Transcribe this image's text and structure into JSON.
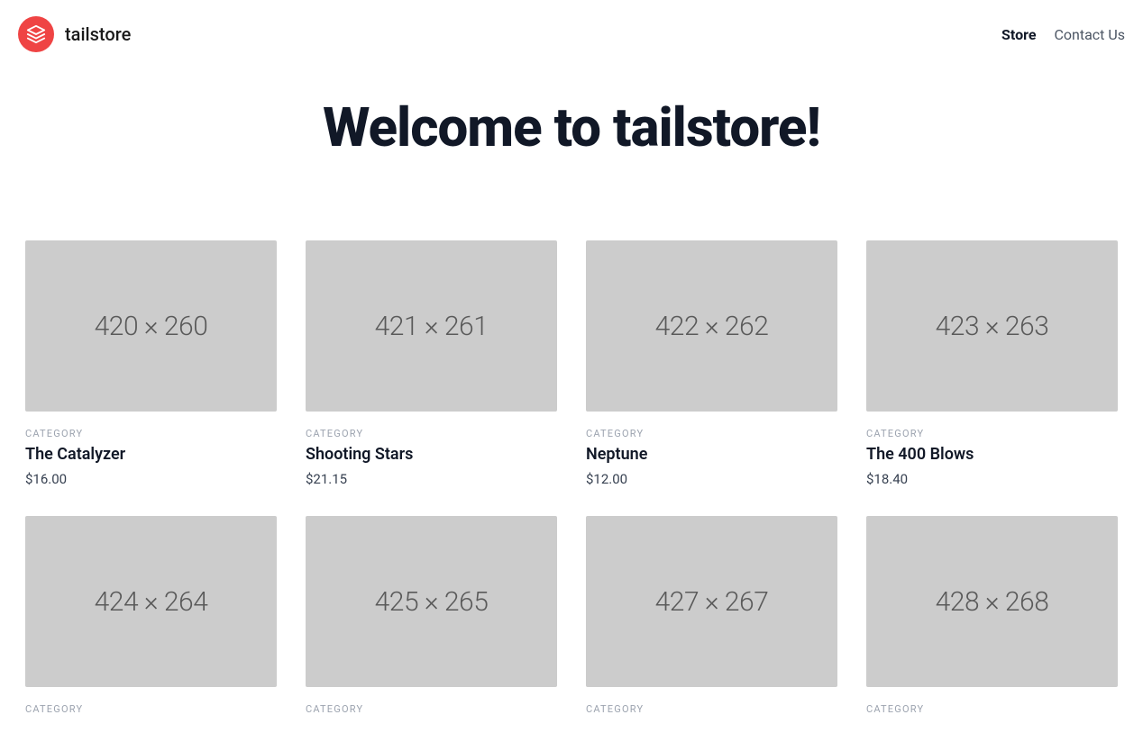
{
  "header": {
    "brand_name": "tailstore",
    "nav": [
      {
        "label": "Store",
        "active": true
      },
      {
        "label": "Contact Us",
        "active": false
      }
    ]
  },
  "hero": {
    "title": "Welcome to tailstore!"
  },
  "products": [
    {
      "category": "CATEGORY",
      "name": "The Catalyzer",
      "price": "$16.00",
      "img_label": "420 × 260"
    },
    {
      "category": "CATEGORY",
      "name": "Shooting Stars",
      "price": "$21.15",
      "img_label": "421 × 261"
    },
    {
      "category": "CATEGORY",
      "name": "Neptune",
      "price": "$12.00",
      "img_label": "422 × 262"
    },
    {
      "category": "CATEGORY",
      "name": "The 400 Blows",
      "price": "$18.40",
      "img_label": "423 × 263"
    },
    {
      "category": "CATEGORY",
      "name": "",
      "price": "",
      "img_label": "424 × 264"
    },
    {
      "category": "CATEGORY",
      "name": "",
      "price": "",
      "img_label": "425 × 265"
    },
    {
      "category": "CATEGORY",
      "name": "",
      "price": "",
      "img_label": "427 × 267"
    },
    {
      "category": "CATEGORY",
      "name": "",
      "price": "",
      "img_label": "428 × 268"
    }
  ]
}
